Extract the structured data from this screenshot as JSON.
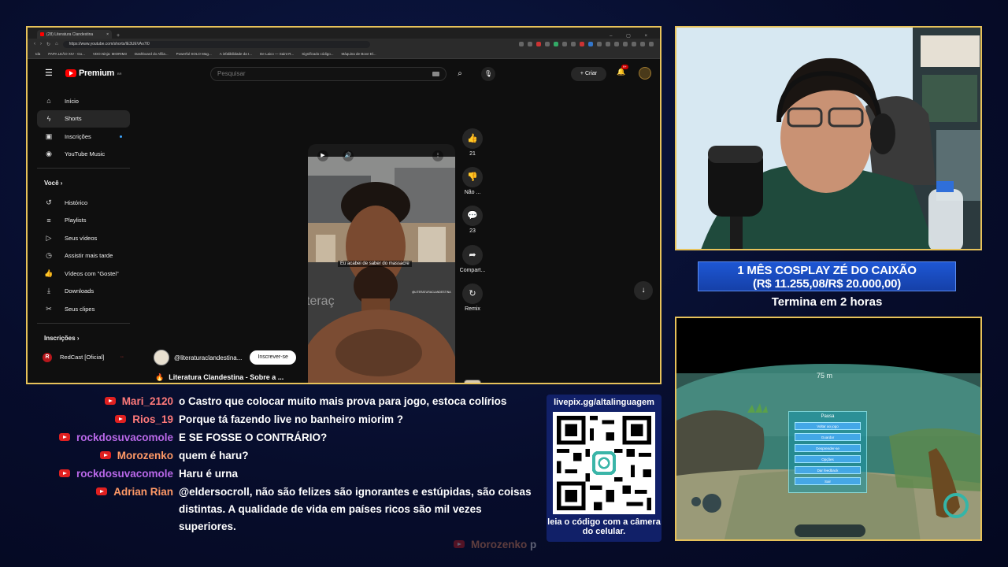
{
  "browser": {
    "tab_title": "(28) Literatura Clandestina",
    "url": "https://www.youtube.com/shorts/lE3UEVAo7I0",
    "bookmarks": [
      "Ida",
      "PAPA LEÃO XIV - Go...",
      "VDO.Ninja: MIORIM3",
      "Dashboard do Afilia...",
      "Powerful SOLO Mag...",
      "A infalibilidade da I...",
      "De Laico — Saint R...",
      "Significado código...",
      "Máquina de Bove El..."
    ]
  },
  "youtube": {
    "logo_text": "Premium",
    "logo_region": "BR",
    "search_placeholder": "Pesquisar",
    "create_label": "Criar",
    "notif_count": "9+",
    "nav": [
      {
        "icon": "home-icon",
        "label": "Início"
      },
      {
        "icon": "shorts-icon",
        "label": "Shorts"
      },
      {
        "icon": "subscriptions-icon",
        "label": "Inscrições"
      },
      {
        "icon": "youtube-music-icon",
        "label": "YouTube Music"
      }
    ],
    "you_title": "Você",
    "you_items": [
      {
        "icon": "history-icon",
        "label": "Histórico"
      },
      {
        "icon": "playlists-icon",
        "label": "Playlists"
      },
      {
        "icon": "your-videos-icon",
        "label": "Seus vídeos"
      },
      {
        "icon": "watch-later-icon",
        "label": "Assistir mais tarde"
      },
      {
        "icon": "liked-videos-icon",
        "label": "Vídeos com \"Gostei\""
      },
      {
        "icon": "downloads-icon",
        "label": "Downloads"
      },
      {
        "icon": "clips-icon",
        "label": "Seus clipes"
      }
    ],
    "subs_title": "Inscrições",
    "subs_item": "RedCast [Oficial]",
    "short": {
      "caption": "Eu acabei de saber do massacre",
      "watermark": "@LITERATURACLANDESTINA",
      "overlay_text": "teraç",
      "channel": "@literaturaclandestina...",
      "subscribe_label": "Inscrever-se",
      "title": "Literatura Clandestina - Sobre a ..."
    },
    "actions": [
      {
        "icon": "like-icon",
        "label": "21"
      },
      {
        "icon": "dislike-icon",
        "label": "Não ..."
      },
      {
        "icon": "comment-icon",
        "label": "23"
      },
      {
        "icon": "share-icon",
        "label": "Compart..."
      },
      {
        "icon": "remix-icon",
        "label": "Remix"
      }
    ]
  },
  "goal": {
    "line1": "1 MÊS COSPLAY ZÉ DO CAIXÃO",
    "line2": "(R$ 11.255,08/R$ 20.000,00)",
    "ends": "Termina em 2 horas"
  },
  "game": {
    "depth": "75 m",
    "pause_title": "Pausa",
    "pause_options": [
      "Voltar ao jogo",
      "Guardar",
      "Desprender-se",
      "Opções",
      "Dar feedback",
      "Sair"
    ]
  },
  "chat": [
    {
      "user": "Mari_2120",
      "color": "#ff7a7a",
      "text": "o Castro que colocar muito mais prova para jogo, estoca colírios"
    },
    {
      "user": "Rios_19",
      "color": "#ff7a7a",
      "text": "Porque tá fazendo live no banheiro miorim ?"
    },
    {
      "user": "rockdosuvacomole",
      "color": "#b968e8",
      "text": "E SE FOSSE O CONTRÁRIO?"
    },
    {
      "user": "Morozenko",
      "color": "#ff9966",
      "text": "quem é haru?"
    },
    {
      "user": "rockdosuvacomole",
      "color": "#b968e8",
      "text": "Haru é urna"
    },
    {
      "user": "Adrian Rian",
      "color": "#ff9966",
      "text": "@eldersocroll, não são felizes são ignorantes e estúpidas, são coisas distintas. A qualidade de vida em países ricos são mil vezes superiores."
    },
    {
      "user": "Morozenko",
      "color": "#ff9966",
      "text": "p"
    }
  ],
  "qr": {
    "url": "livepix.gg/altalinguagem",
    "caption": "leia o código com a câmera do celular."
  }
}
